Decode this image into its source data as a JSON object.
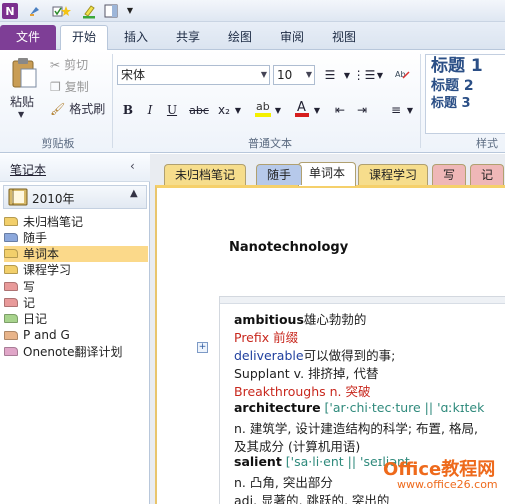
{
  "app": {
    "logo_letter": "N"
  },
  "tabs": [
    "文件",
    "开始",
    "插入",
    "共享",
    "绘图",
    "审阅",
    "视图"
  ],
  "ribbon": {
    "clipboard": {
      "paste": "粘贴",
      "cut": "剪切",
      "copy": "复制",
      "format_painter": "格式刷",
      "label": "剪贴板"
    },
    "font": {
      "name": "宋体",
      "size": "10",
      "label": "普通文本",
      "bold": "B",
      "italic": "I",
      "underline": "U",
      "strike": "abc",
      "subscript": "x₂"
    },
    "styles": {
      "h1": "标题 1",
      "h2": "标题 2",
      "h3": "标题 3",
      "label": "样式"
    }
  },
  "nav": {
    "title": "笔记本",
    "notebook": "2010年",
    "sections": [
      {
        "label": "未归档笔记",
        "color": "#f2cf6b"
      },
      {
        "label": "随手",
        "color": "#8ca8dc"
      },
      {
        "label": "单词本",
        "color": "#f2cf6b"
      },
      {
        "label": "课程学习",
        "color": "#f2cf6b"
      },
      {
        "label": "写",
        "color": "#e89a9a"
      },
      {
        "label": "记",
        "color": "#e89a9a"
      },
      {
        "label": "日记",
        "color": "#a7d38c"
      },
      {
        "label": "P and G",
        "color": "#e8b48a"
      },
      {
        "label": "Onenote翻译计划",
        "color": "#e0a6c8"
      }
    ]
  },
  "section_tabs": [
    {
      "label": "未归档笔记",
      "color": "#f6dd8c"
    },
    {
      "label": "随手",
      "color": "#b6c9ea"
    },
    {
      "label": "单词本",
      "color": "#ffffff"
    },
    {
      "label": "课程学习",
      "color": "#f6dd8c"
    },
    {
      "label": "写",
      "color": "#efb7b7"
    },
    {
      "label": "记",
      "color": "#efb7b7"
    }
  ],
  "page": {
    "title": "Nanotechnology",
    "lines": [
      {
        "a": "ambitious",
        "b": "雄心勃勃的"
      },
      {
        "a": "Prefix  前缀"
      },
      {
        "a": "deliverable",
        "b": "可以做得到的事;"
      },
      {
        "a": "Supplant",
        "b": " v.  排挤掉, 代替"
      },
      {
        "a": "Breakthroughs  n.  突破"
      },
      {
        "a": "architecture",
        "b": "  ['ar·chi·tec·ture || 'ɑːkɪtek"
      },
      {
        "a": "n.  建筑学, 设计建造结构的科学; 布置, 格局,"
      },
      {
        "a": "及其成分 (计算机用语)"
      },
      {
        "a": "salient",
        "b": "  ['sa·li·ent || 'seɪljənt"
      },
      {
        "a": "n.  凸角, 突出部分"
      },
      {
        "a": "adj.  显著的, 跳跃的, 突出的"
      }
    ]
  },
  "watermark": {
    "text": "Office教程网",
    "url": "www.office26.com"
  }
}
